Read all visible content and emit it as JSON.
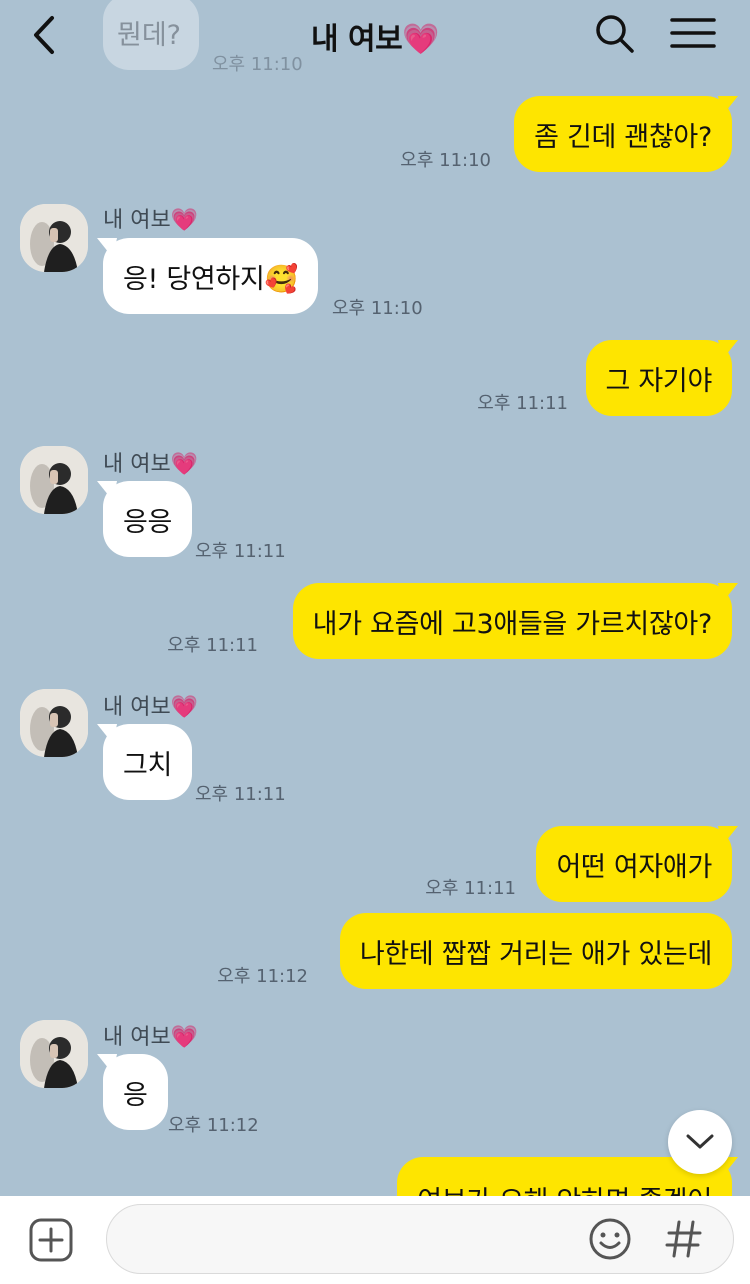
{
  "header": {
    "title": "내 여보💗"
  },
  "previous": {
    "text": "뭔데?",
    "time": "오후 11:10"
  },
  "messages": [
    {
      "side": "me",
      "text": "좀 긴데 괜찮아?",
      "time": "오후 11:10"
    },
    {
      "side": "them",
      "sender": "내 여보💗",
      "text": "응! 당연하지🥰",
      "time": "오후 11:10"
    },
    {
      "side": "me",
      "text": "그 자기야",
      "time": "오후 11:11"
    },
    {
      "side": "them",
      "sender": "내 여보💗",
      "text": "응응",
      "time": "오후 11:11"
    },
    {
      "side": "me",
      "text": "내가 요즘에 고3애들을 가르치잖아?",
      "time": "오후 11:11"
    },
    {
      "side": "them",
      "sender": "내 여보💗",
      "text": "그치",
      "time": "오후 11:11"
    },
    {
      "side": "me",
      "text": "어떤 여자애가",
      "time": "오후 11:11"
    },
    {
      "side": "me",
      "text": "나한테 짭짭 거리는 애가 있는데",
      "time": "오후 11:12"
    },
    {
      "side": "them",
      "sender": "내 여보💗",
      "text": "응",
      "time": "오후 11:12"
    },
    {
      "side": "me",
      "text": "여보가 오해 안하면 좋겠어",
      "time": ""
    }
  ],
  "composer": {
    "value": "",
    "placeholder": ""
  },
  "icons": {
    "back": "chevron-left-icon",
    "search": "search-icon",
    "menu": "hamburger-menu-icon",
    "scroll": "chevron-down-icon",
    "plus": "plus-square-icon",
    "emoji": "smile-icon",
    "hash": "hash-icon"
  },
  "colors": {
    "background": "#abc1d1",
    "my_bubble": "#fee500",
    "their_bubble": "#ffffff"
  }
}
